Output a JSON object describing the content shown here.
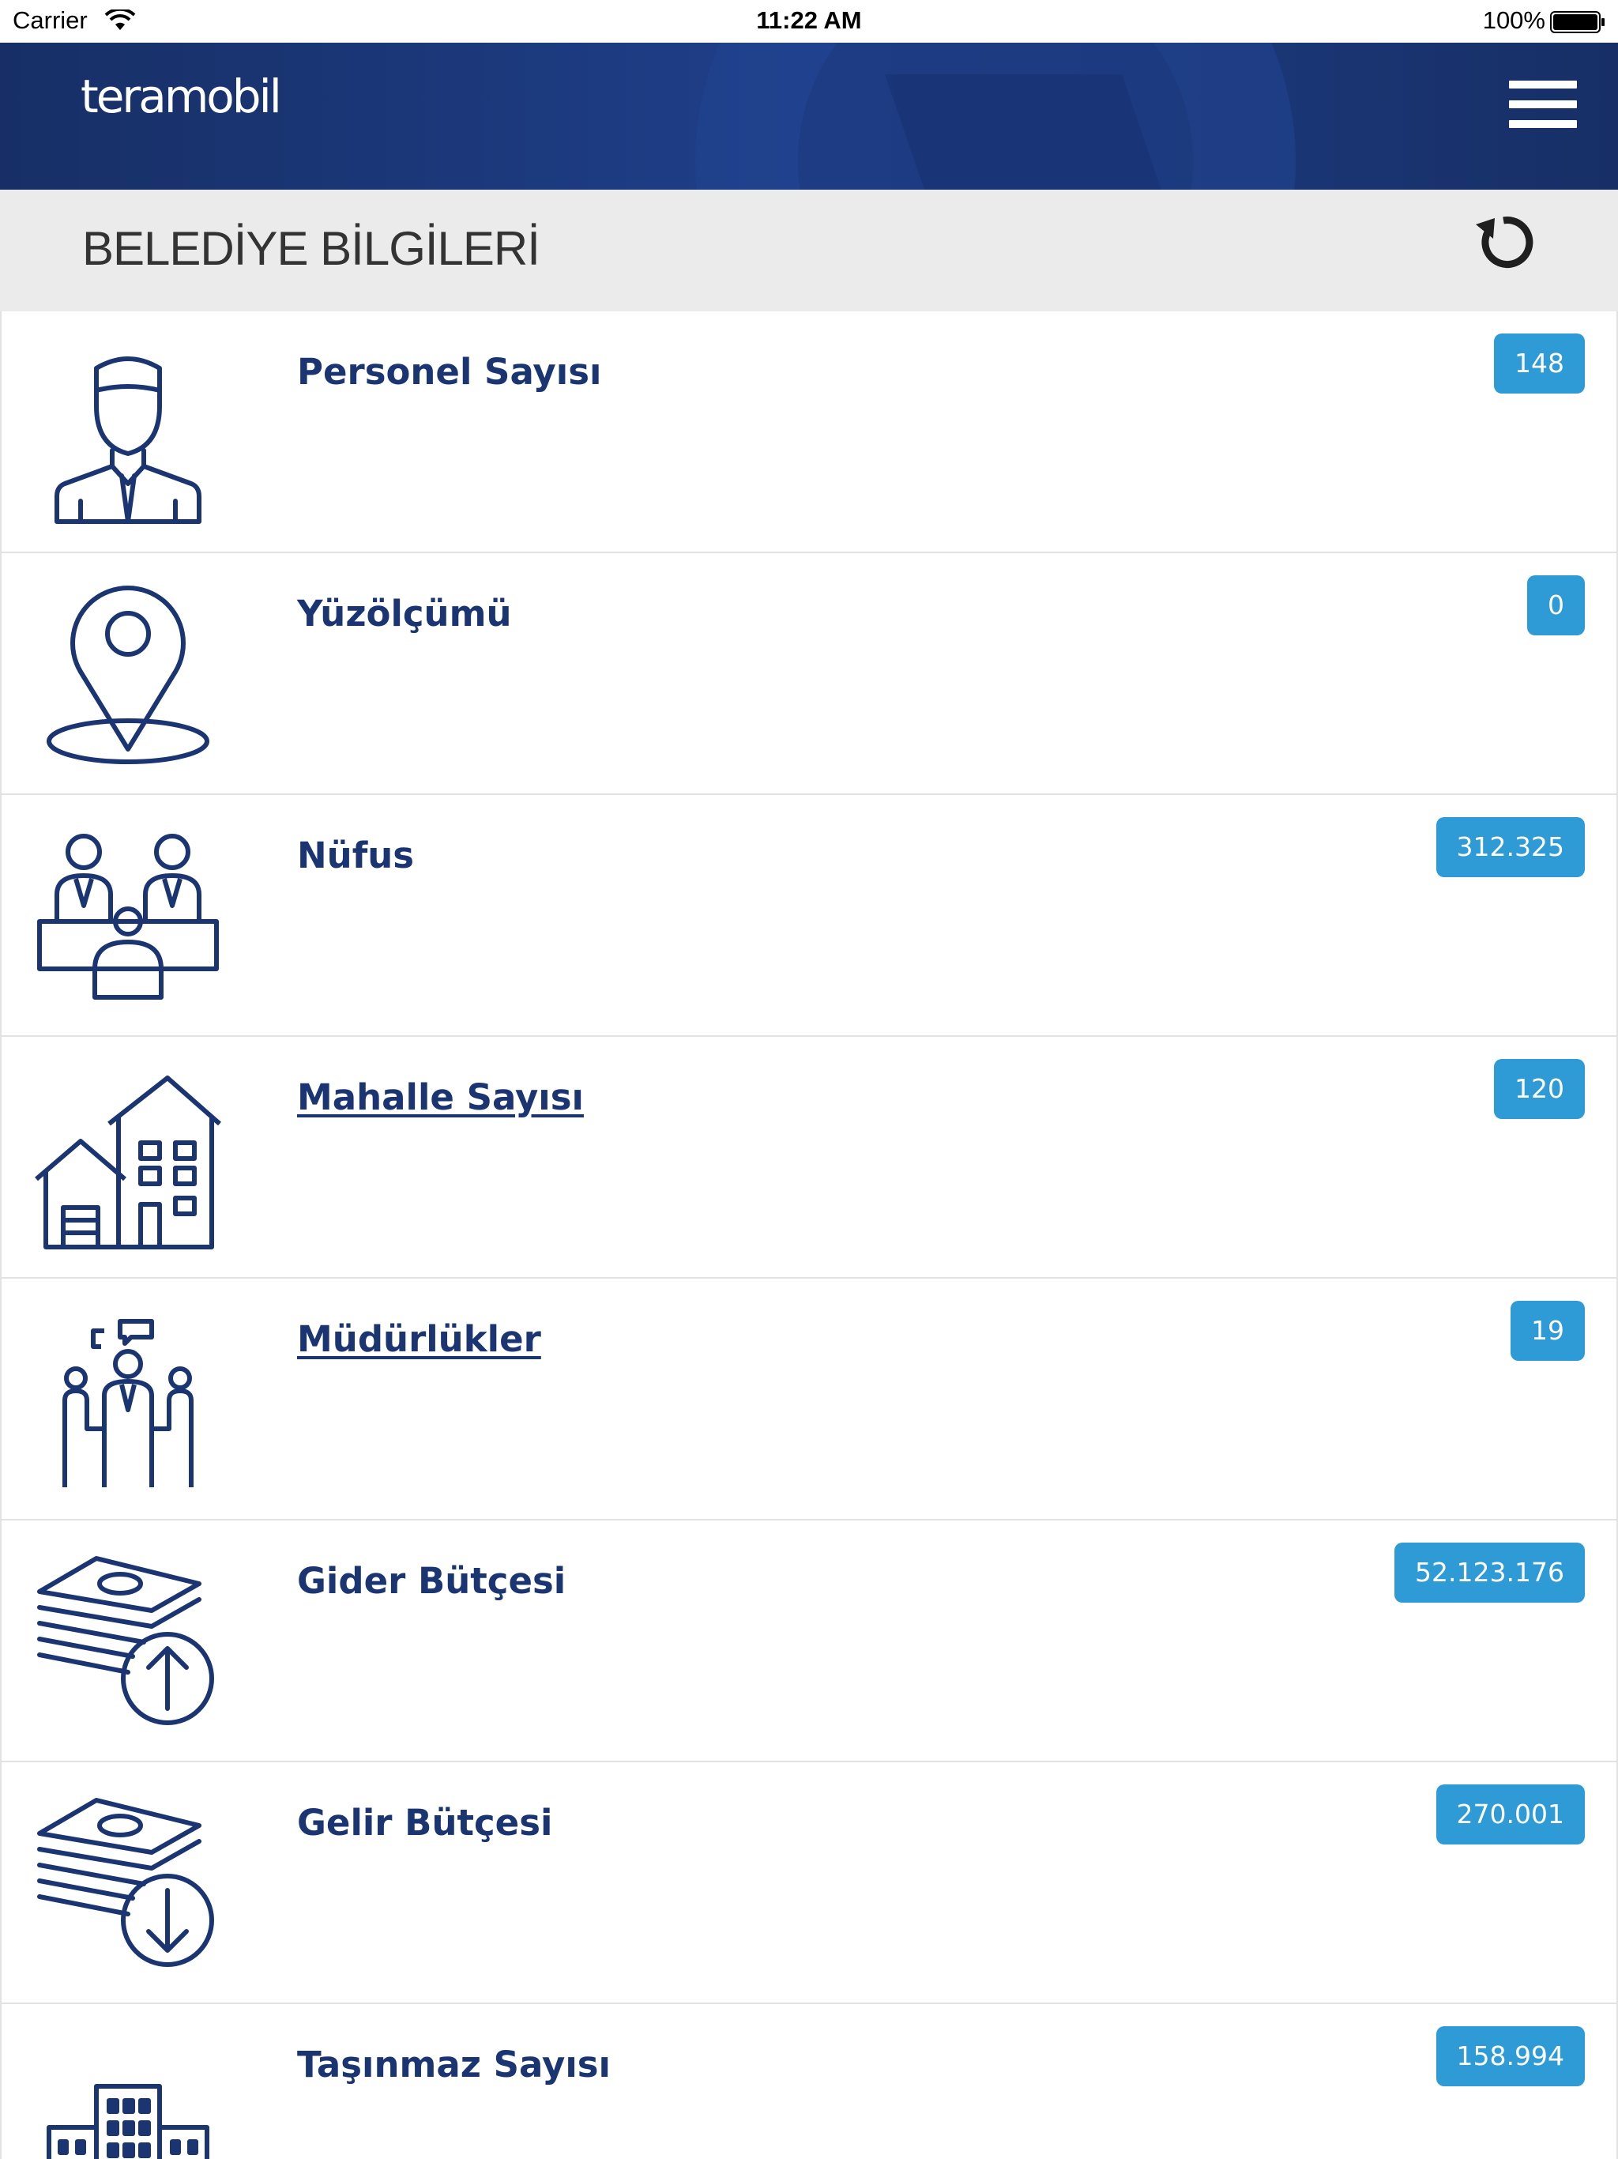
{
  "status_bar": {
    "carrier": "Carrier",
    "time": "11:22 AM",
    "battery": "100%"
  },
  "header": {
    "logo": "teramobil",
    "menu_icon": "hamburger-menu-icon"
  },
  "subheader": {
    "title": "BELEDİYE BİLGİLERİ",
    "refresh_icon": "refresh-icon"
  },
  "items": [
    {
      "label": "Personel Sayısı",
      "value": "148",
      "icon": "employee-icon",
      "link": false
    },
    {
      "label": "Yüzölçümü",
      "value": "0",
      "icon": "location-pin-icon",
      "link": false
    },
    {
      "label": "Nüfus",
      "value": "312.325",
      "icon": "population-icon",
      "link": false
    },
    {
      "label": "Mahalle Sayısı",
      "value": "120",
      "icon": "houses-icon",
      "link": true
    },
    {
      "label": "Müdürlükler",
      "value": "19",
      "icon": "meeting-icon",
      "link": true
    },
    {
      "label": "Gider Bütçesi",
      "value": "52.123.176",
      "icon": "money-up-icon",
      "link": false
    },
    {
      "label": "Gelir Bütçesi",
      "value": "270.001",
      "icon": "money-down-icon",
      "link": false
    },
    {
      "label": "Taşınmaz Sayısı",
      "value": "158.994",
      "icon": "buildings-icon",
      "link": false
    }
  ],
  "colors": {
    "brand": "#1a3572",
    "badge": "#2e9ad6",
    "subheader_bg": "#ebebeb"
  }
}
